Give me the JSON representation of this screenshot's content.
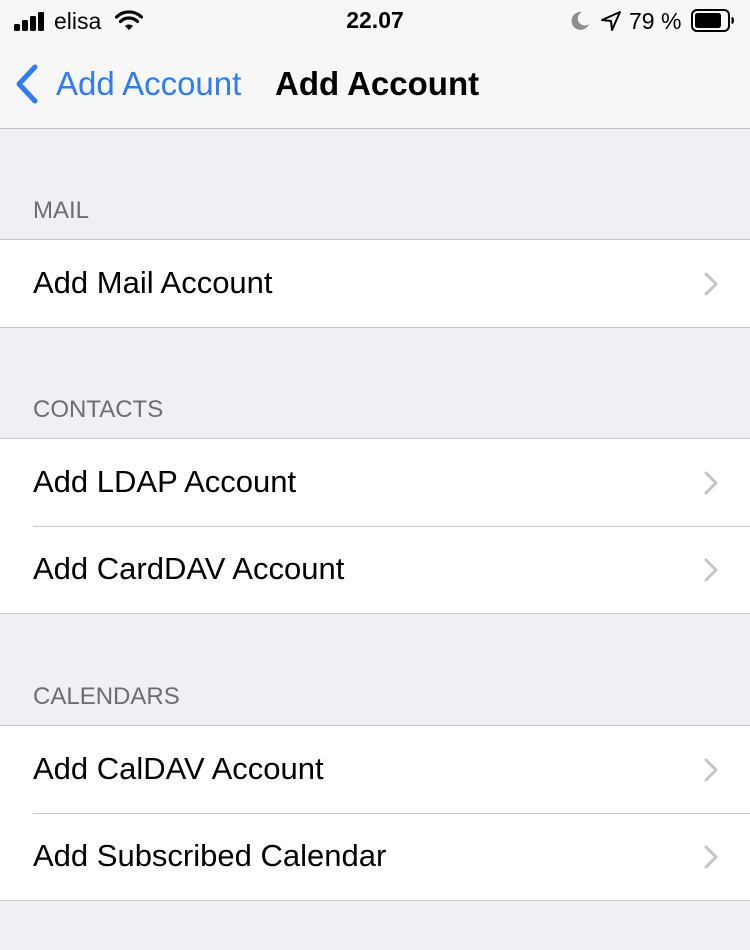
{
  "status_bar": {
    "carrier": "elisa",
    "time": "22.07",
    "battery_percent": "79 %",
    "icons": [
      "signal-icon",
      "wifi-icon",
      "moon-icon",
      "location-arrow-icon",
      "battery-icon"
    ]
  },
  "nav": {
    "back_label": "Add Account",
    "title": "Add Account",
    "accent_color": "#2f7cf6"
  },
  "sections": {
    "mail": {
      "header": "MAIL",
      "items": [
        {
          "label": "Add Mail Account"
        }
      ]
    },
    "contacts": {
      "header": "CONTACTS",
      "items": [
        {
          "label": "Add LDAP Account"
        },
        {
          "label": "Add CardDAV Account"
        }
      ]
    },
    "calendars": {
      "header": "CALENDARS",
      "items": [
        {
          "label": "Add CalDAV Account"
        },
        {
          "label": "Add Subscribed Calendar"
        }
      ]
    }
  },
  "colors": {
    "background": "#efeff4",
    "section_header": "#6d6d72",
    "separator": "#c8c7cc",
    "chevron": "#c4c4c7"
  }
}
